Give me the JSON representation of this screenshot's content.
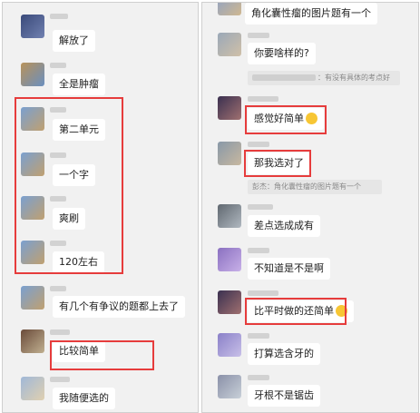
{
  "left": {
    "messages": [
      {
        "text": "解放了"
      },
      {
        "text": "全是肿瘤"
      },
      {
        "text": "第二单元"
      },
      {
        "text": "一个字"
      },
      {
        "text": "爽刷"
      },
      {
        "text": "120左右"
      },
      {
        "text": "有几个有争议的题都上去了"
      },
      {
        "text": "比较简单"
      },
      {
        "text": "我随便选的"
      }
    ]
  },
  "right": {
    "top_fragment": "角化囊性瘤的图片题有一个",
    "messages": [
      {
        "text": "你要啥样的?"
      },
      {
        "quote": "：有没有具体的考点好"
      },
      {
        "text": "感觉好简单",
        "emoji": "grin-emoji"
      },
      {
        "text": "那我选对了"
      },
      {
        "quote": "彭杰：角化囊性瘤的图片题有一个"
      },
      {
        "text": "差点选成成有"
      },
      {
        "text": "不知道是不是啊"
      },
      {
        "text": "比平时做的还简单",
        "emoji": "laugh-emoji"
      },
      {
        "text": "打算选含牙的"
      },
      {
        "text": "牙根不是锯齿"
      }
    ]
  },
  "colors": {
    "chat_bg": "#f1f1f1",
    "bubble_bg": "#ffffff",
    "highlight": "#e63c3c",
    "quote_bg": "#e6e6e6"
  }
}
